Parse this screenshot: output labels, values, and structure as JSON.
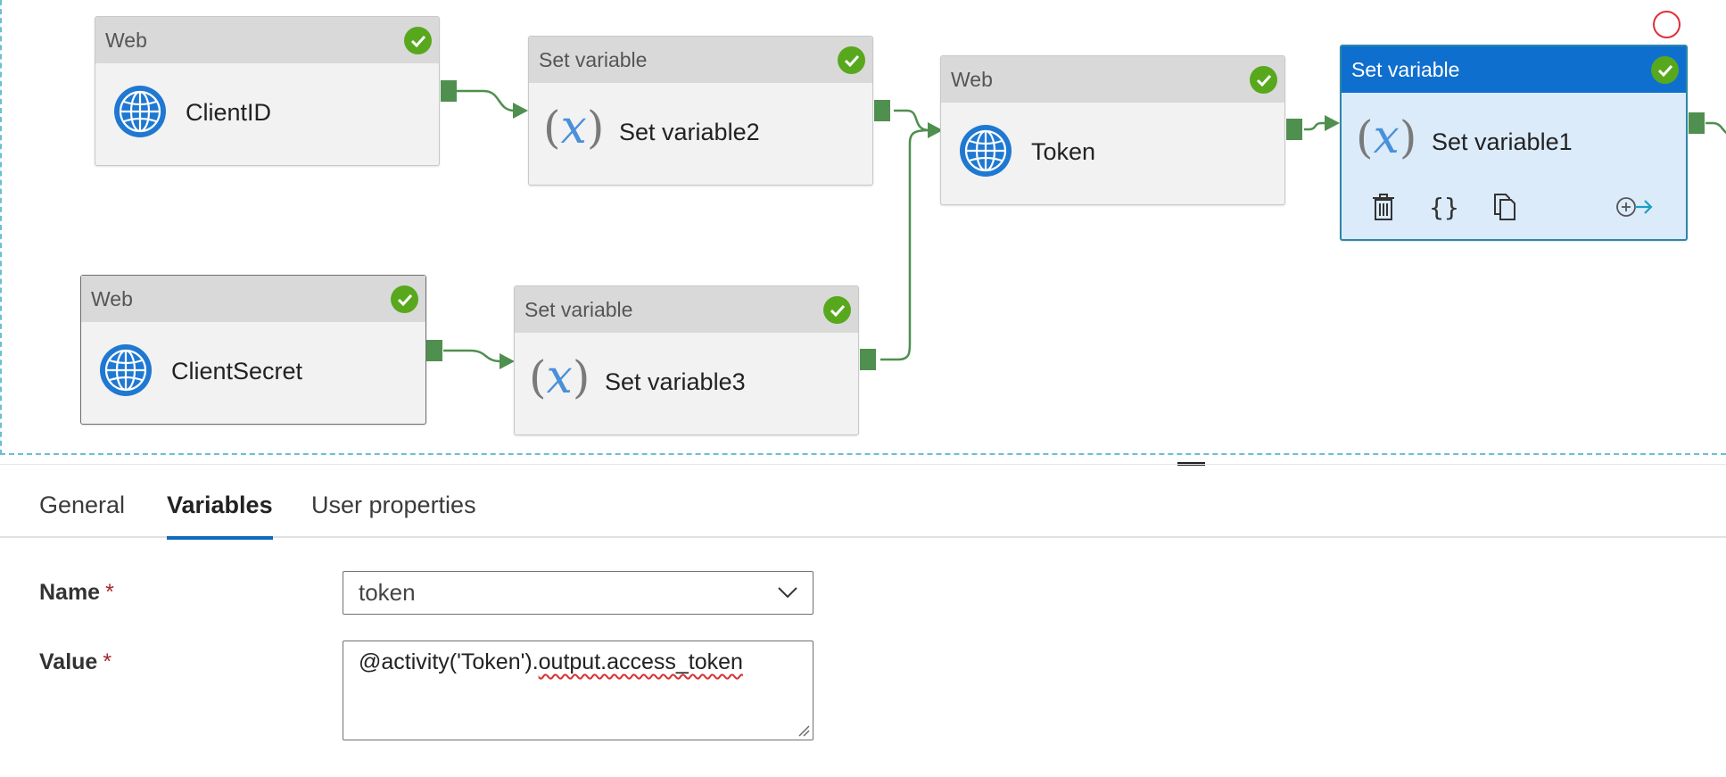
{
  "pipeline": {
    "activities": [
      {
        "id": "clientid",
        "type": "Web",
        "name": "ClientID"
      },
      {
        "id": "setvar2",
        "type": "Set variable",
        "name": "Set variable2"
      },
      {
        "id": "token",
        "type": "Web",
        "name": "Token"
      },
      {
        "id": "setvar1",
        "type": "Set variable",
        "name": "Set variable1",
        "selected": true
      },
      {
        "id": "clientsecret",
        "type": "Web",
        "name": "ClientSecret"
      },
      {
        "id": "setvar3",
        "type": "Set variable",
        "name": "Set variable3"
      }
    ],
    "status_color": "#58a81e",
    "connector_color": "#4f8f4f",
    "selected_header_color": "#0f6fcf",
    "node_actions": [
      "delete-icon",
      "code-braces-icon",
      "copy-icon",
      "add-output-icon"
    ]
  },
  "properties": {
    "tabs": [
      {
        "label": "General",
        "active": false
      },
      {
        "label": "Variables",
        "active": true
      },
      {
        "label": "User properties",
        "active": false
      }
    ],
    "fields": {
      "name_label": "Name",
      "name_value": "token",
      "value_label": "Value",
      "value_prefix": "@activity('Token').",
      "value_marked": "output.access_token",
      "required_mark": "*"
    },
    "accent_color": "#0f6cbd"
  }
}
